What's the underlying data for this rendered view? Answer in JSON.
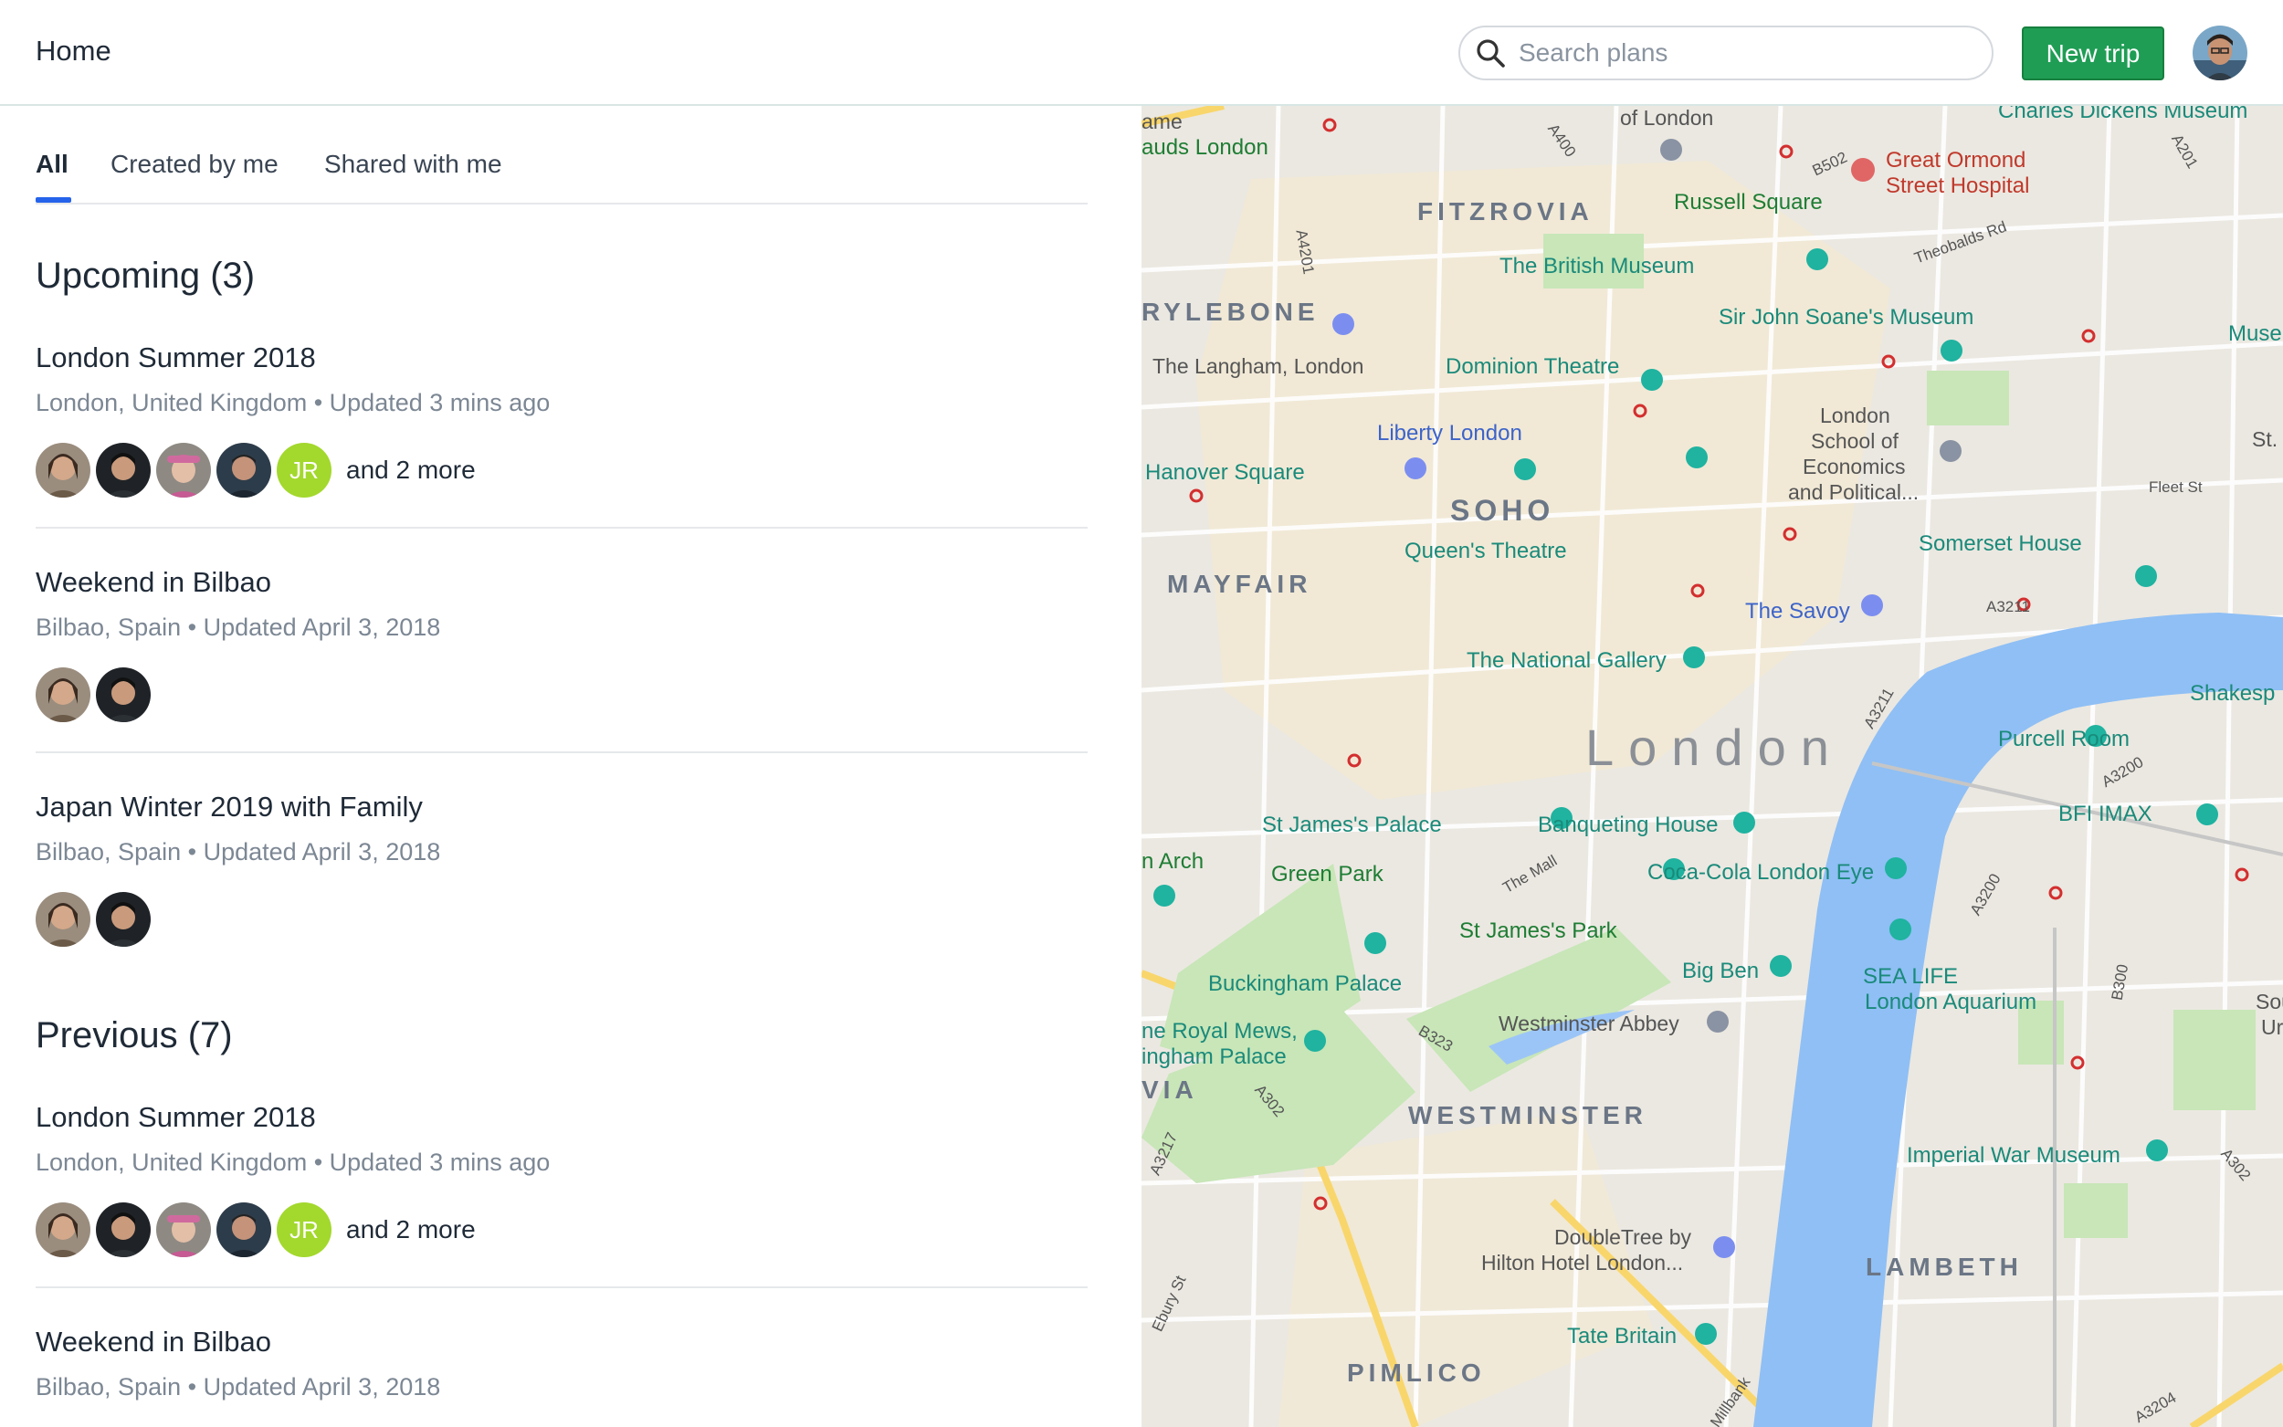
{
  "header": {
    "title": "Home",
    "search_placeholder": "Search plans",
    "new_trip_label": "New trip"
  },
  "tabs": [
    {
      "label": "All",
      "active": true
    },
    {
      "label": "Created by me",
      "active": false
    },
    {
      "label": "Shared with me",
      "active": false
    }
  ],
  "upcoming": {
    "title": "Upcoming (3)",
    "trips": [
      {
        "name": "London Summer 2018",
        "meta": "London, United Kingdom • Updated 3 mins ago",
        "initials": "JR",
        "more": "and 2 more"
      },
      {
        "name": "Weekend in Bilbao",
        "meta": "Bilbao, Spain • Updated April 3, 2018"
      },
      {
        "name": "Japan Winter 2019 with Family",
        "meta": "Bilbao, Spain • Updated April 3, 2018"
      }
    ]
  },
  "previous": {
    "title": "Previous (7)",
    "trips": [
      {
        "name": "London Summer 2018",
        "meta": "London, United Kingdom • Updated 3 mins ago",
        "initials": "JR",
        "more": "and 2 more"
      },
      {
        "name": "Weekend in Bilbao",
        "meta": "Bilbao, Spain • Updated April 3, 2018"
      }
    ]
  },
  "map": {
    "city": "London",
    "areas": {
      "fitzrovia": "FITZROVIA",
      "marylebone": "RYLEBONE",
      "soho": "SOHO",
      "mayfair": "MAYFAIR",
      "westminster": "WESTMINSTER",
      "lambeth": "LAMBETH",
      "pimlico": "PIMLICO",
      "via": "VIA"
    },
    "places": {
      "ame": "ame",
      "auds": "auds London",
      "of_london": "of London",
      "charles_dickens": "Charles Dickens Museum",
      "great_ormond": "Great Ormond",
      "street_hospital": "Street Hospital",
      "russell_square": "Russell Square",
      "british_museum": "The British Museum",
      "soane": "Sir John Soane's Museum",
      "museu": "Museu",
      "langham": "The Langham, London",
      "dominion": "Dominion Theatre",
      "liberty": "Liberty London",
      "hanover": "Hanover Square",
      "lse1": "London",
      "lse2": "School of",
      "lse3": "Economics",
      "lse4": "and Political...",
      "st_p": "St. P",
      "fleet_st": "Fleet St",
      "queens_theatre": "Queen's Theatre",
      "somerset": "Somerset House",
      "savoy": "The Savoy",
      "national_gallery": "The National Gallery",
      "shakesp": "Shakesp",
      "purcell": "Purcell Room",
      "bfi": "BFI IMAX",
      "arch": "n Arch",
      "st_james_palace": "St James's Palace",
      "banqueting": "Banqueting House",
      "green_park": "Green Park",
      "the_mall": "The Mall",
      "coca_cola": "Coca-Cola London Eye",
      "st_james_park": "St James's Park",
      "buckingham": "Buckingham Palace",
      "big_ben": "Big Ben",
      "sea_life1": "SEA LIFE",
      "sea_life2": "London Aquarium",
      "sou": "Sou",
      "ur": "Ur",
      "royal_mews1": "ne Royal Mews,",
      "royal_mews2": "ingham Palace",
      "westminster_abbey": "Westminster Abbey",
      "iwm": "Imperial War Museum",
      "doubletree1": "DoubleTree by",
      "doubletree2": "Hilton Hotel London...",
      "tate": "Tate Britain",
      "theobalds": "Theobalds Rd",
      "millbank": "Millbank",
      "ebury": "Ebury St"
    },
    "roads": {
      "a400": "A400",
      "b502": "B502",
      "a201": "A201",
      "a4201": "A4201",
      "a3211": "A3211",
      "a3211b": "A3211",
      "a3200": "A3200",
      "a3200b": "A3200",
      "b300": "B300",
      "a302": "A302",
      "a302b": "A302",
      "b323": "B323",
      "a3217": "A3217",
      "a3204": "A3204"
    }
  }
}
